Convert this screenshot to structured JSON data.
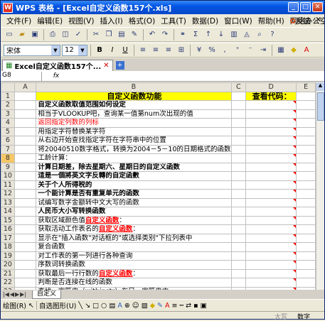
{
  "window": {
    "app_label": "WPS 表格",
    "title": "WPS 表格 - [Excel自定义函数157个.xls]"
  },
  "menu": {
    "items": [
      "文件(F)",
      "编辑(E)",
      "视图(V)",
      "插入(I)",
      "格式(O)",
      "工具(T)",
      "数据(D)",
      "窗口(W)",
      "帮助(H)",
      "网络办公空间(Y)"
    ],
    "feedback": "反馈"
  },
  "format_toolbar": {
    "font_name": "宋体",
    "font_size": "12",
    "bold": "B",
    "italic": "I",
    "underline": "U",
    "percent": "%"
  },
  "doc_tab": {
    "label": "Excel自定义函数157个..."
  },
  "formula_bar": {
    "cell_ref": "G8",
    "fx": "fx"
  },
  "columns": [
    "A",
    "B",
    "C",
    "D",
    "E"
  ],
  "rows": [
    {
      "num": "1",
      "b": "自定义函数功能",
      "d": "查看代码："
    },
    {
      "num": "2",
      "b": "自定义函数取值范围如何设定",
      "style": "bold"
    },
    {
      "num": "3",
      "b": "相当于VLOOKUP吧，查询某一值第num次出现的值"
    },
    {
      "num": "4",
      "b": "返回指定列数的列标",
      "style": "red"
    },
    {
      "num": "5",
      "b": "用指定字符替换某字符"
    },
    {
      "num": "6",
      "b": "从右边开始查找指定字符在字符串中的位置"
    },
    {
      "num": "7",
      "b": "将20040510数字格式，转换为2004－5－10的日期格式的函数"
    },
    {
      "num": "8",
      "b": "工龄计算："
    },
    {
      "num": "9",
      "b": "计算日期差，除去星期六、星期日的自定义函数",
      "style": "bold"
    },
    {
      "num": "10",
      "b": "這是一個將英文字反轉的自定函數",
      "style": "bold"
    },
    {
      "num": "11",
      "b": "关于个人所得税的",
      "style": "bold"
    },
    {
      "num": "12",
      "b": "一个能计算是否有重复单元的函数",
      "style": "bold"
    },
    {
      "num": "13",
      "b": "试编写数字金额转中文大写的函数"
    },
    {
      "num": "14",
      "b": "人民币大小写转换函数",
      "style": "bold"
    },
    {
      "num": "15",
      "b": "获取区域颜色值",
      "b2": "自定义函数",
      "b3": "："
    },
    {
      "num": "16",
      "b": "获取活动工作表名的",
      "b2": "自定义函数",
      "b3": "："
    },
    {
      "num": "17",
      "b": "显示在\"插入函数\"对话框的\"或选择类别\"下拉列表中"
    },
    {
      "num": "18",
      "b": "复合函数"
    },
    {
      "num": "19",
      "b": "对工作表的第一列进行各种查询"
    },
    {
      "num": "20",
      "b": "序数词转换函数"
    },
    {
      "num": "21",
      "b": "获取最后一行行数的",
      "b2": "自定义函数",
      "b3": "："
    },
    {
      "num": "22",
      "b": "判断是否连接在线的函数"
    },
    {
      "num": "23",
      "b": "查找一字符串（withinstr）在另一字符串中"
    }
  ],
  "sheet_tabs": [
    "自定义"
  ],
  "draw_toolbar": {
    "draw_label": "绘图(R)",
    "autoshape_label": "自选图形(U)"
  },
  "status": {
    "caps": "大写",
    "num": "数字"
  }
}
